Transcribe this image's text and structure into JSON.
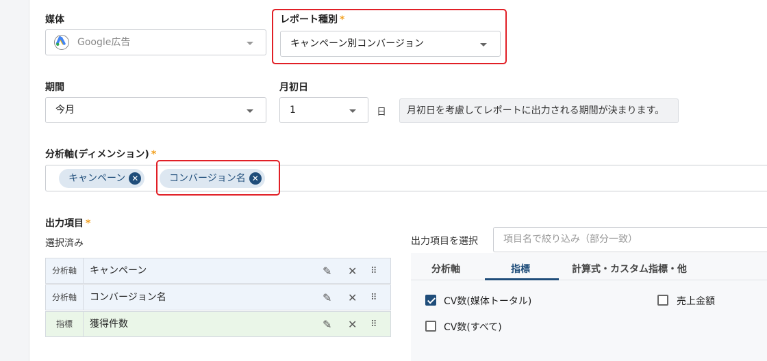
{
  "media": {
    "label": "媒体",
    "value": "Google広告",
    "icon": "google-ads-icon"
  },
  "report_type": {
    "label": "レポート種別",
    "required": "*",
    "value": "キャンペーン別コンバージョン"
  },
  "period": {
    "label": "期間",
    "value": "今月"
  },
  "month_start": {
    "label": "月初日",
    "value": "1",
    "unit": "日",
    "note": "月初日を考慮してレポートに出力される期間が決まります。"
  },
  "dimensions": {
    "label": "分析軸(ディメンション)",
    "required": "*",
    "chips": [
      "キャンペーン",
      "コンバージョン名"
    ]
  },
  "output": {
    "label": "出力項目",
    "required": "*",
    "selected_label": "選択済み",
    "rows": [
      {
        "tag": "分析軸",
        "name": "キャンペーン",
        "kind": "dimension"
      },
      {
        "tag": "分析軸",
        "name": "コンバージョン名",
        "kind": "dimension"
      },
      {
        "tag": "指標",
        "name": "獲得件数",
        "kind": "metric"
      }
    ]
  },
  "picker": {
    "label": "出力項目を選択",
    "search_placeholder": "項目名で絞り込み（部分一致）",
    "tabs": [
      "分析軸",
      "指標",
      "計算式・カスタム指標・他"
    ],
    "active_tab": 1,
    "options": [
      {
        "label": "CV数(媒体トータル)",
        "checked": true
      },
      {
        "label": "売上金額",
        "checked": false
      },
      {
        "label": "CV数(すべて)",
        "checked": false
      }
    ]
  },
  "colors": {
    "accent": "#1f4d7a",
    "highlight_frame": "#e11f26",
    "required": "#f2a01f"
  }
}
